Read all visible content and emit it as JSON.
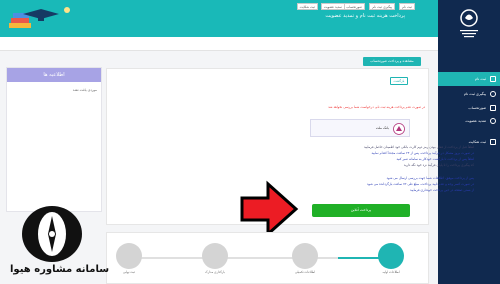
{
  "header": {
    "title": "پرداخت هزینه ثبت نام و تمدید عضویت",
    "accent": "#19b9b8"
  },
  "breadcrumbs": [
    "ثبت نام",
    "پیگیری ثبت نام",
    "صورتحساب",
    "تمدید عضویت",
    "ثبت شکایت"
  ],
  "sidebar": {
    "background": "#10294f",
    "items": [
      {
        "label": "ثبت نام",
        "active": true,
        "icon": "form-icon"
      },
      {
        "label": "پیگیری ثبت نام",
        "active": false,
        "icon": "search-icon"
      },
      {
        "label": "صورتحساب",
        "active": false,
        "icon": "bill-icon"
      },
      {
        "label": "تمدید عضویت",
        "active": false,
        "icon": "refresh-icon"
      },
      {
        "label": "ثبت شکایت",
        "active": false,
        "icon": "message-icon"
      }
    ]
  },
  "announcements": {
    "title": "اطلاعیه ها",
    "text": "موردی یافت نشد"
  },
  "main": {
    "section_tag": "مشاهده و پرداخت صورتحساب",
    "back_label": "بازگشت",
    "warning": "در صورت عدم پرداخت هزینه ثبت نام، درخواست شما بررسی نخواهد شد",
    "bank_name": "بانک ملت",
    "paragraphs": [
      "لطفاً قبل از پرداخت از فعال بودن رمز دوم کارت بانکی خود اطمینان حاصل فرمایید",
      "در صورت بروز مشکل در فرآیند پرداخت، پس از ۲۴ ساعت مجدداً اقدام نمایید",
      "لطفاً پس از پرداخت تا بازگشت خودکار به سامانه صبر کنید",
      "کد پیگیری پرداخت را تا پایان فرآیند نزد خود نگه دارید",
      "پس از پرداخت موفق، اطلاعات شما جهت بررسی ارسال می شود",
      "در صورت کسر وجه و عدم تایید پرداخت، مبلغ طی ۷۲ ساعت بازگردانده می شود",
      "از بستن صفحه در حین پرداخت خودداری فرمایید"
    ],
    "pay_button": "پرداخت آنلاین"
  },
  "steps": {
    "items": [
      {
        "label": "اطلاعات اولیه",
        "active": true
      },
      {
        "label": "اطلاعات تکمیلی",
        "active": false
      },
      {
        "label": "بارگذاری مدارک",
        "active": false
      },
      {
        "label": "ثبت نهایی",
        "active": false
      }
    ]
  },
  "watermark": {
    "text": "سامانه مشاوره هیوا"
  }
}
